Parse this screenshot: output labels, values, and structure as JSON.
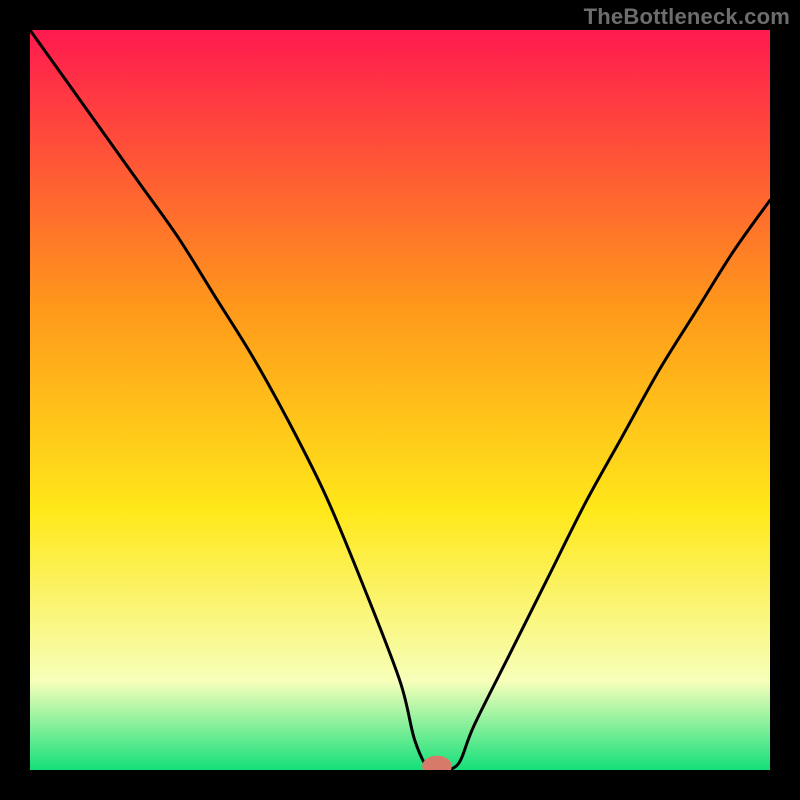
{
  "watermark": "TheBottleneck.com",
  "chart_data": {
    "type": "line",
    "title": "",
    "xlabel": "",
    "ylabel": "",
    "xlim": [
      0,
      100
    ],
    "ylim": [
      0,
      100
    ],
    "grid": false,
    "legend": false,
    "gradient_background": {
      "top": "#ff1a4f",
      "mid1": "#ff9a1a",
      "mid2": "#ffe81a",
      "mid3": "#f7ffba",
      "bottom": "#14e07a"
    },
    "series": [
      {
        "name": "bottleneck-curve",
        "x": [
          0,
          5,
          10,
          15,
          20,
          25,
          30,
          35,
          40,
          45,
          50,
          52,
          54,
          56,
          58,
          60,
          65,
          70,
          75,
          80,
          85,
          90,
          95,
          100
        ],
        "y": [
          100,
          93,
          86,
          79,
          72,
          64,
          56,
          47,
          37,
          25,
          12,
          4,
          0,
          0,
          1,
          6,
          16,
          26,
          36,
          45,
          54,
          62,
          70,
          77
        ]
      }
    ],
    "marker": {
      "name": "optimal-point",
      "x": 55,
      "y": 0.5,
      "color": "#d87a6a",
      "rx": 1.2,
      "ry": 0.9
    }
  }
}
